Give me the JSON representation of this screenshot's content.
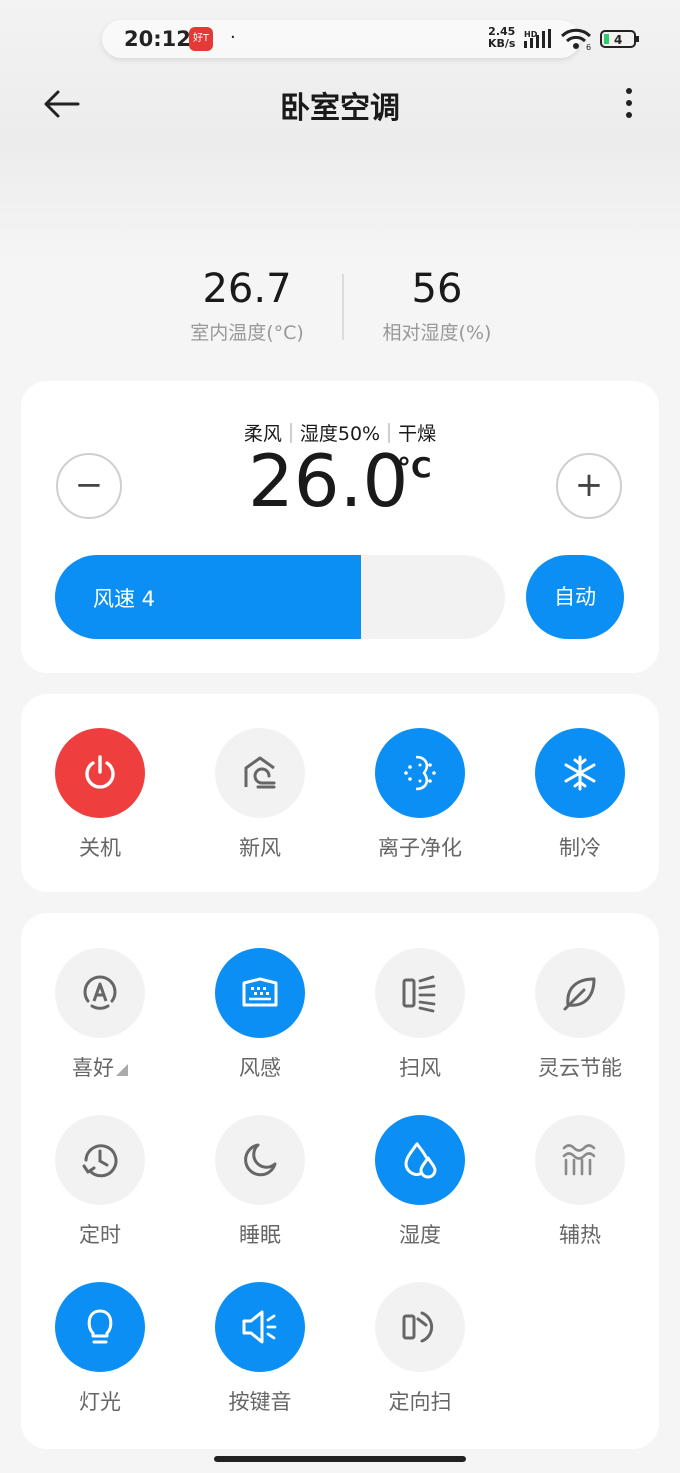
{
  "status_bar": {
    "time": "20:12",
    "app_icon_text": "好T",
    "notification_dot": "·",
    "net_speed_value": "2.45",
    "net_speed_unit": "KB/s",
    "network_badge": "HD",
    "wifi_badge": "6",
    "battery_level": "4"
  },
  "header": {
    "title": "卧室空调",
    "back_icon": "arrow-left-icon",
    "more_icon": "more-vertical-icon"
  },
  "readings": {
    "indoor_temp": {
      "value": "26.7",
      "label": "室内温度(°C)"
    },
    "humidity": {
      "value": "56",
      "label": "相对湿度(%)"
    }
  },
  "control": {
    "mode_tags": [
      "柔风",
      "湿度50%",
      "干燥"
    ],
    "set_temp": "26.0",
    "temp_unit": "°C",
    "minus_label": "−",
    "plus_label": "+",
    "fan_speed_label": "风速 4",
    "fan_speed_fraction": 0.68,
    "auto_label": "自动"
  },
  "primary_functions": [
    {
      "label": "关机",
      "icon": "power-icon",
      "state": "red"
    },
    {
      "label": "新风",
      "icon": "fresh-air-icon",
      "state": "off"
    },
    {
      "label": "离子净化",
      "icon": "ion-purify-icon",
      "state": "on"
    },
    {
      "label": "制冷",
      "icon": "snowflake-icon",
      "state": "on"
    }
  ],
  "secondary_functions": [
    {
      "label": "喜好",
      "icon": "preference-icon",
      "state": "off"
    },
    {
      "label": "风感",
      "icon": "wind-feel-icon",
      "state": "on"
    },
    {
      "label": "扫风",
      "icon": "swing-icon",
      "state": "off"
    },
    {
      "label": "灵云节能",
      "icon": "leaf-icon",
      "state": "off"
    },
    {
      "label": "定时",
      "icon": "timer-icon",
      "state": "off"
    },
    {
      "label": "睡眠",
      "icon": "moon-icon",
      "state": "off"
    },
    {
      "label": "湿度",
      "icon": "humidity-drop-icon",
      "state": "on"
    },
    {
      "label": "辅热",
      "icon": "aux-heat-icon",
      "state": "off"
    },
    {
      "label": "灯光",
      "icon": "light-bulb-icon",
      "state": "on"
    },
    {
      "label": "按键音",
      "icon": "speaker-icon",
      "state": "on"
    },
    {
      "label": "定向扫",
      "icon": "directional-swing-icon",
      "state": "off"
    }
  ],
  "colors": {
    "accent": "#0b8ff5",
    "power_red": "#ef3e3e",
    "inactive_circle": "#f2f2f2",
    "label_gray": "#666666"
  }
}
